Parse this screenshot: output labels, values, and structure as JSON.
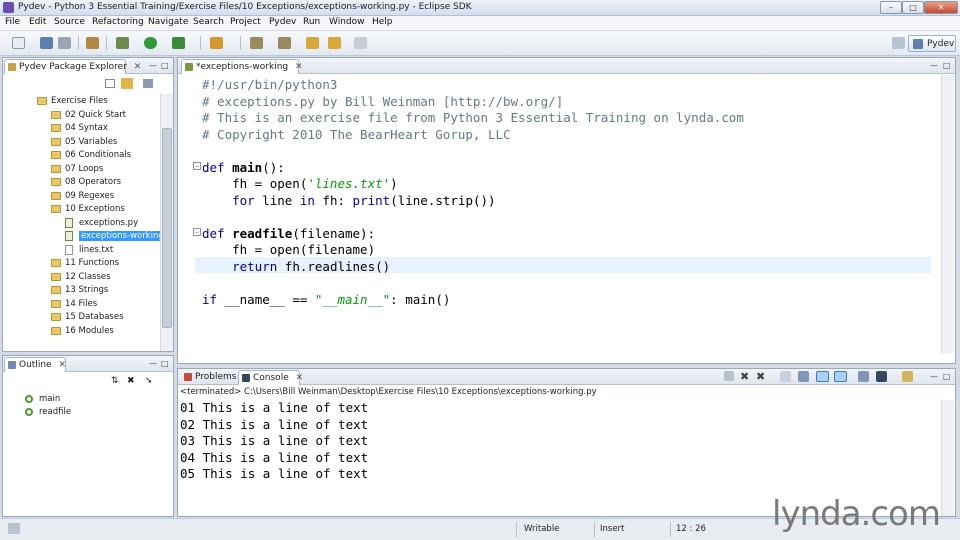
{
  "window": {
    "title": "Pydev - Python 3 Essential Training/Exercise Files/10 Exceptions/exceptions-working.py - Eclipse SDK"
  },
  "menu": [
    "File",
    "Edit",
    "Source",
    "Refactoring",
    "Navigate",
    "Search",
    "Project",
    "Pydev",
    "Run",
    "Window",
    "Help"
  ],
  "perspective": {
    "label": "Pydev"
  },
  "explorer": {
    "tab_label": "Pydev Package Explorer",
    "items": [
      {
        "label": "Exercise Files",
        "kind": "folder"
      },
      {
        "label": "02 Quick Start",
        "kind": "folder"
      },
      {
        "label": "04 Syntax",
        "kind": "folder"
      },
      {
        "label": "05 Variables",
        "kind": "folder"
      },
      {
        "label": "06 Conditionals",
        "kind": "folder"
      },
      {
        "label": "07 Loops",
        "kind": "folder"
      },
      {
        "label": "08 Operators",
        "kind": "folder"
      },
      {
        "label": "09 Regexes",
        "kind": "folder"
      },
      {
        "label": "10 Exceptions",
        "kind": "folder"
      },
      {
        "label": "exceptions.py",
        "kind": "py"
      },
      {
        "label": "exceptions-working.",
        "kind": "py",
        "selected": true
      },
      {
        "label": "lines.txt",
        "kind": "file"
      },
      {
        "label": "11 Functions",
        "kind": "folder"
      },
      {
        "label": "12 Classes",
        "kind": "folder"
      },
      {
        "label": "13 Strings",
        "kind": "folder"
      },
      {
        "label": "14 Files",
        "kind": "folder"
      },
      {
        "label": "15 Databases",
        "kind": "folder"
      },
      {
        "label": "16 Modules",
        "kind": "folder"
      }
    ]
  },
  "outline": {
    "tab_label": "Outline",
    "items": [
      {
        "label": "main"
      },
      {
        "label": "readfile"
      }
    ]
  },
  "editor": {
    "tab_label": "*exceptions-working",
    "lines": [
      [
        {
          "t": "#!/usr/bin/python3",
          "c": "cm"
        }
      ],
      [
        {
          "t": "# exceptions.py by Bill Weinman [http://bw.org/]",
          "c": "cm"
        }
      ],
      [
        {
          "t": "# This is an exercise file from Python 3 Essential Training on lynda.com",
          "c": "cm"
        }
      ],
      [
        {
          "t": "# Copyright 2010 The BearHeart Gorup, LLC",
          "c": "cm"
        }
      ],
      [
        {
          "t": "",
          "c": "plain"
        }
      ],
      [
        {
          "t": "def ",
          "c": "kw"
        },
        {
          "t": "main",
          "c": "fn"
        },
        {
          "t": "():",
          "c": "plain"
        }
      ],
      [
        {
          "t": "    fh = open(",
          "c": "plain"
        },
        {
          "t": "'lines.txt'",
          "c": "st"
        },
        {
          "t": ")",
          "c": "plain"
        }
      ],
      [
        {
          "t": "    ",
          "c": "plain"
        },
        {
          "t": "for",
          "c": "kw"
        },
        {
          "t": " line ",
          "c": "plain"
        },
        {
          "t": "in",
          "c": "kw"
        },
        {
          "t": " fh: ",
          "c": "plain"
        },
        {
          "t": "print",
          "c": "kw"
        },
        {
          "t": "(line.strip())",
          "c": "plain"
        }
      ],
      [
        {
          "t": "",
          "c": "plain"
        }
      ],
      [
        {
          "t": "def ",
          "c": "kw"
        },
        {
          "t": "readfile",
          "c": "fn"
        },
        {
          "t": "(filename):",
          "c": "plain"
        }
      ],
      [
        {
          "t": "    fh = open(filename)",
          "c": "plain"
        }
      ],
      [
        {
          "t": "    ",
          "c": "plain"
        },
        {
          "t": "return",
          "c": "kw"
        },
        {
          "t": " fh.readlines()",
          "c": "plain"
        }
      ],
      [
        {
          "t": "",
          "c": "plain"
        }
      ],
      [
        {
          "t": "if",
          "c": "kw"
        },
        {
          "t": " __name__ == ",
          "c": "plain"
        },
        {
          "t": "\"__main__\"",
          "c": "st"
        },
        {
          "t": ": main()",
          "c": "plain"
        }
      ]
    ]
  },
  "console": {
    "tabs": [
      "Problems",
      "Console"
    ],
    "header": "<terminated> C:\\Users\\Bill Weinman\\Desktop\\Exercise Files\\10 Exceptions\\exceptions-working.py",
    "lines": [
      "01 This is a line of text",
      "02 This is a line of text",
      "03 This is a line of text",
      "04 This is a line of text",
      "05 This is a line of text"
    ]
  },
  "status": {
    "writable": "Writable",
    "insert": "Insert",
    "position": "12 : 26"
  },
  "brand": {
    "logo": "lynda.com"
  },
  "colors": {
    "selection": "#3399ff",
    "comment": "#5f7a8c",
    "keyword": "#0000a0",
    "string": "#00a000"
  }
}
